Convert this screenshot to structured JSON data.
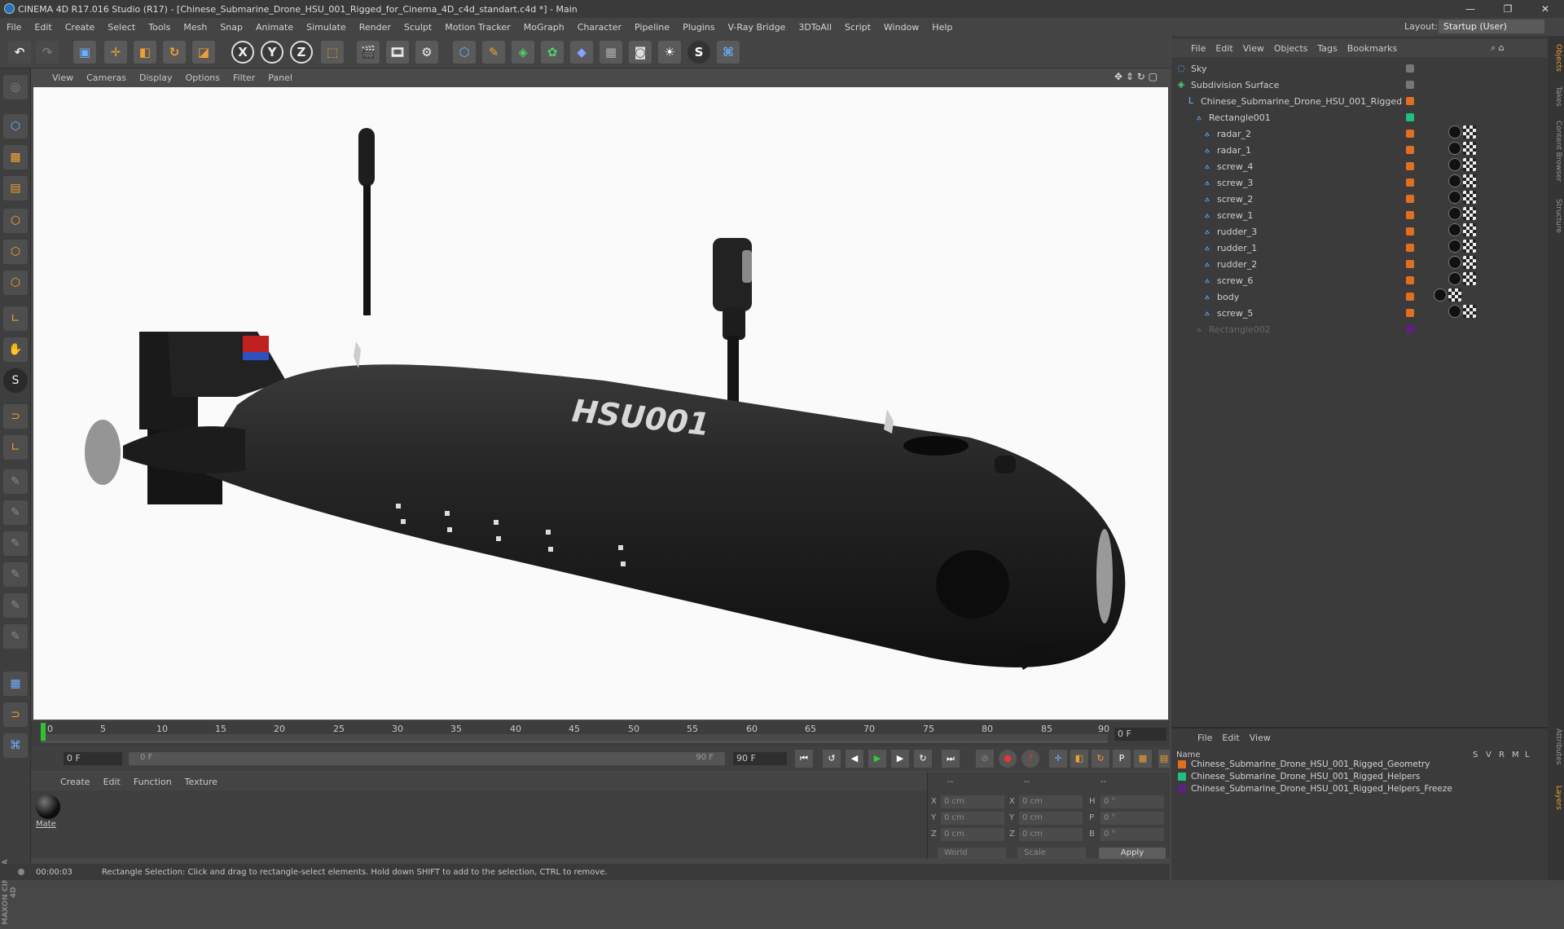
{
  "app": {
    "title": "CINEMA 4D R17.016 Studio (R17) - [Chinese_Submarine_Drone_HSU_001_Rigged_for_Cinema_4D_c4d_standart.c4d *] - Main",
    "layout_label": "Layout:",
    "layout_value": "Startup (User)"
  },
  "menu": [
    "File",
    "Edit",
    "Create",
    "Select",
    "Tools",
    "Mesh",
    "Snap",
    "Animate",
    "Simulate",
    "Render",
    "Sculpt",
    "Motion Tracker",
    "MoGraph",
    "Character",
    "Pipeline",
    "Plugins",
    "V-Ray Bridge",
    "3DToAll",
    "Script",
    "Window",
    "Help"
  ],
  "toolbar": {
    "x": "X",
    "y": "Y",
    "z": "Z"
  },
  "viewport": {
    "menu": [
      "View",
      "Cameras",
      "Display",
      "Options",
      "Filter",
      "Panel"
    ],
    "hull_label": "HSU001"
  },
  "objects": {
    "menu": [
      "File",
      "Edit",
      "View",
      "Objects",
      "Tags",
      "Bookmarks"
    ],
    "items": [
      {
        "name": "Sky",
        "indent": 0,
        "color": "#777777"
      },
      {
        "name": "Subdivision Surface",
        "indent": 0,
        "color": "#777777"
      },
      {
        "name": "Chinese_Submarine_Drone_HSU_001_Rigged",
        "indent": 1,
        "color": "#e07020"
      },
      {
        "name": "Rectangle001",
        "indent": 2,
        "color": "#20c080"
      },
      {
        "name": "radar_2",
        "indent": 3,
        "color": "#e07020"
      },
      {
        "name": "radar_1",
        "indent": 3,
        "color": "#e07020"
      },
      {
        "name": "screw_4",
        "indent": 3,
        "color": "#e07020"
      },
      {
        "name": "screw_3",
        "indent": 3,
        "color": "#e07020"
      },
      {
        "name": "screw_2",
        "indent": 3,
        "color": "#e07020"
      },
      {
        "name": "screw_1",
        "indent": 3,
        "color": "#e07020"
      },
      {
        "name": "rudder_3",
        "indent": 3,
        "color": "#e07020"
      },
      {
        "name": "rudder_1",
        "indent": 3,
        "color": "#e07020"
      },
      {
        "name": "rudder_2",
        "indent": 3,
        "color": "#e07020"
      },
      {
        "name": "screw_6",
        "indent": 3,
        "color": "#e07020"
      },
      {
        "name": "body",
        "indent": 3,
        "color": "#e07020"
      },
      {
        "name": "screw_5",
        "indent": 3,
        "color": "#e07020"
      },
      {
        "name": "Rectangle002",
        "indent": 2,
        "color": "#602080"
      }
    ]
  },
  "timeline": {
    "ticks": [
      "0",
      "5",
      "10",
      "15",
      "20",
      "25",
      "30",
      "35",
      "40",
      "45",
      "50",
      "55",
      "60",
      "65",
      "70",
      "75",
      "80",
      "85",
      "90"
    ],
    "current_frame": "0 F",
    "start_field": "0 F",
    "slider_start": "0 F",
    "slider_end": "90 F",
    "end_field": "90 F"
  },
  "materials": {
    "menu": [
      "Create",
      "Edit",
      "Function",
      "Texture"
    ],
    "items": [
      {
        "name": "Mate"
      }
    ]
  },
  "coords": {
    "header": [
      "--",
      "--",
      "--"
    ],
    "rows": [
      {
        "a": "X",
        "av": "0 cm",
        "b": "X",
        "bv": "0 cm",
        "c": "H",
        "cv": "0 °"
      },
      {
        "a": "Y",
        "av": "0 cm",
        "b": "Y",
        "bv": "0 cm",
        "c": "P",
        "cv": "0 °"
      },
      {
        "a": "Z",
        "av": "0 cm",
        "b": "Z",
        "bv": "0 cm",
        "c": "B",
        "cv": "0 °"
      }
    ],
    "world": "World",
    "scale": "Scale",
    "apply": "Apply"
  },
  "layers": {
    "menu": [
      "File",
      "Edit",
      "View"
    ],
    "headers": {
      "name": "Name",
      "s": "S",
      "v": "V",
      "r": "R",
      "m": "M",
      "l": "L"
    },
    "items": [
      {
        "name": "Chinese_Submarine_Drone_HSU_001_Rigged_Geometry",
        "color": "#e07020"
      },
      {
        "name": "Chinese_Submarine_Drone_HSU_001_Rigged_Helpers",
        "color": "#20c080"
      },
      {
        "name": "Chinese_Submarine_Drone_HSU_001_Rigged_Helpers_Freeze",
        "color": "#602080"
      }
    ]
  },
  "side_tabs": [
    "Objects",
    "Takes",
    "Content Browser",
    "Structure",
    "Attributes",
    "Layers"
  ],
  "status": {
    "time": "00:00:03",
    "message": "Rectangle Selection: Click and drag to rectangle-select elements. Hold down SHIFT to add to the selection, CTRL to remove."
  },
  "brand": "MAXON CINEMA 4D"
}
